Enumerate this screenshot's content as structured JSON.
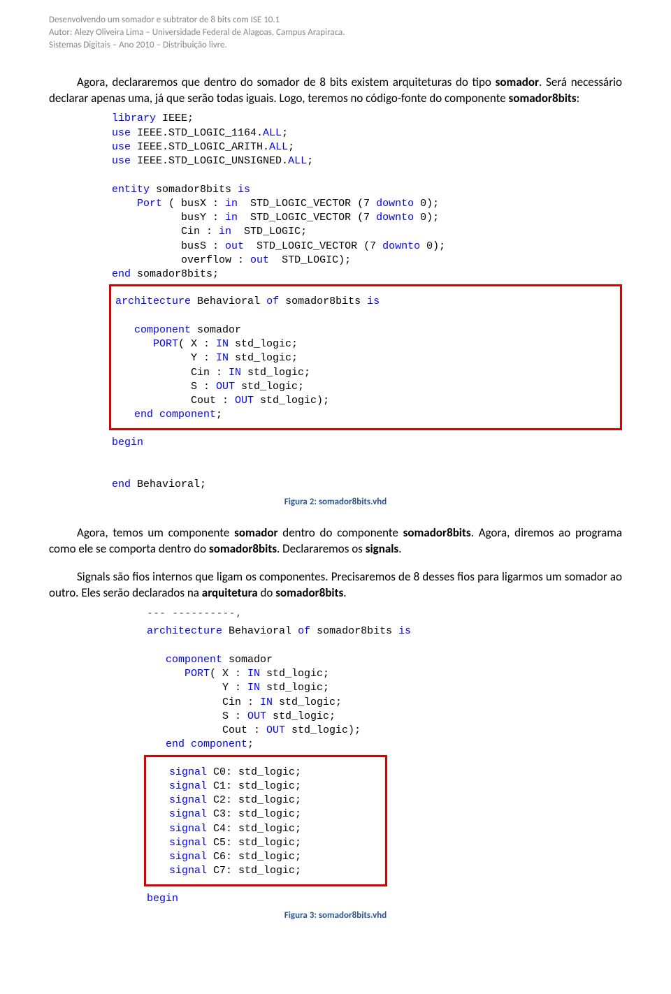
{
  "meta": {
    "line1": "Desenvolvendo um somador e subtrator de 8 bits com ISE 10.1",
    "line2": "Autor: Alezy Oliveira Lima – Universidade Federal de Alagoas, Campus Arapiraca.",
    "line3": "Sistemas Digitais – Ano 2010 – Distribuição livre."
  },
  "para1_a": "Agora, declararemos que dentro do somador de 8 bits existem arquiteturas do tipo ",
  "para1_b": "somador",
  "para1_c": ". Será necessário declarar apenas uma, já que serão todas iguais. Logo, teremos no código-fonte do componente ",
  "para1_d": "somador8bits",
  "para1_e": ":",
  "code1": {
    "l1a": "library",
    "l1b": " IEEE;",
    "l2a": "use",
    "l2b": " IEEE.STD_LOGIC_1164.",
    "l2c": "ALL",
    "l2d": ";",
    "l3a": "use",
    "l3b": " IEEE.STD_LOGIC_ARITH.",
    "l3c": "ALL",
    "l3d": ";",
    "l4a": "use",
    "l4b": " IEEE.STD_LOGIC_UNSIGNED.",
    "l4c": "ALL",
    "l4d": ";",
    "l5a": "entity",
    "l5b": " somador8bits ",
    "l5c": "is",
    "l6a": "    Port",
    "l6b": " ( busX : ",
    "l6c": "in",
    "l6d": "  STD_LOGIC_VECTOR (7 ",
    "l6e": "downto",
    "l6f": " 0);",
    "l7b": "           busY : ",
    "l7c": "in",
    "l7d": "  STD_LOGIC_VECTOR (7 ",
    "l7e": "downto",
    "l7f": " 0);",
    "l8b": "           Cin : ",
    "l8c": "in",
    "l8d": "  STD_LOGIC;",
    "l9b": "           busS : ",
    "l9c": "out",
    "l9d": "  STD_LOGIC_VECTOR (7 ",
    "l9e": "downto",
    "l9f": " 0);",
    "l10b": "           overflow : ",
    "l10c": "out",
    "l10d": "  STD_LOGIC);",
    "l11a": "end",
    "l11b": " somador8bits;",
    "r1a": "architecture",
    "r1b": " Behavioral ",
    "r1c": "of",
    "r1d": " somador8bits ",
    "r1e": "is",
    "r2a": "   component",
    "r2b": " somador",
    "r3a": "      PORT",
    "r3b": "( X : ",
    "r3c": "IN",
    "r3d": " std_logic;",
    "r4b": "            Y : ",
    "r4c": "IN",
    "r4d": " std_logic;",
    "r5b": "            Cin : ",
    "r5c": "IN",
    "r5d": " std_logic;",
    "r6b": "            S : ",
    "r6c": "OUT",
    "r6d": " std_logic;",
    "r7b": "            Cout : ",
    "r7c": "OUT",
    "r7d": " std_logic);",
    "r8a": "   end",
    "r8b": " ",
    "r8c": "component",
    "r8d": ";",
    "b1": "begin",
    "e1a": "end",
    "e1b": " Behavioral;"
  },
  "fig2": "Figura 2: somador8bits.vhd",
  "para2_a": "Agora, temos um componente ",
  "para2_b": "somador",
  "para2_c": " dentro do componente ",
  "para2_d": "somador8bits",
  "para2_e": ". Agora, diremos ao programa como ele se comporta dentro do ",
  "para2_f": "somador8bits",
  "para2_g": ". Declararemos os ",
  "para2_h": "signals",
  "para2_i": ".",
  "para3_a": "Signals são fios internos que ligam os componentes. Precisaremos de 8 desses fios para ligarmos um somador ao outro. Eles serão declarados na ",
  "para3_b": "arquitetura",
  "para3_c": " do ",
  "para3_d": "somador8bits",
  "para3_e": ".",
  "code2": {
    "top": "--- ----------,",
    "l1a": "architecture",
    "l1b": " Behavioral ",
    "l1c": "of",
    "l1d": " somador8bits ",
    "l1e": "is",
    "l2a": "   component",
    "l2b": " somador",
    "l3a": "      PORT",
    "l3b": "( X : ",
    "l3c": "IN",
    "l3d": " std_logic;",
    "l4b": "            Y : ",
    "l4c": "IN",
    "l4d": " std_logic;",
    "l5b": "            Cin : ",
    "l5c": "IN",
    "l5d": " std_logic;",
    "l6b": "            S : ",
    "l6c": "OUT",
    "l6d": " std_logic;",
    "l7b": "            Cout : ",
    "l7c": "OUT",
    "l7d": " std_logic);",
    "l8a": "   end",
    "l8b": " ",
    "l8c": "component",
    "l8d": ";",
    "s0a": "   signal",
    "s0b": " C0: std_logic;",
    "s1a": "   signal",
    "s1b": " C1: std_logic;",
    "s2a": "   signal",
    "s2b": " C2: std_logic;",
    "s3a": "   signal",
    "s3b": " C3: std_logic;",
    "s4a": "   signal",
    "s4b": " C4: std_logic;",
    "s5a": "   signal",
    "s5b": " C5: std_logic;",
    "s6a": "   signal",
    "s6b": " C6: std_logic;",
    "s7a": "   signal",
    "s7b": " C7: std_logic;",
    "b1": "begin"
  },
  "fig3": "Figura 3: somador8bits.vhd"
}
